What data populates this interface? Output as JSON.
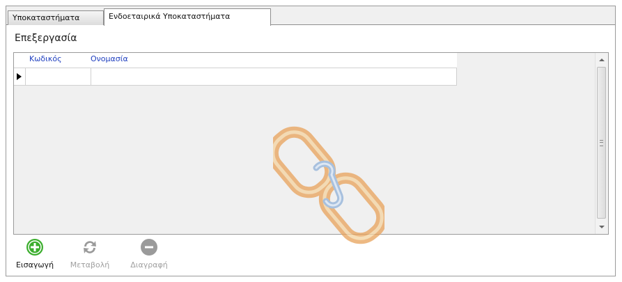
{
  "tabs": [
    {
      "label": "Υποκαταστήματα",
      "active": false
    },
    {
      "label": "Ενδοεταιρικά Υποκαταστήματα",
      "active": true
    }
  ],
  "section": {
    "title": "Επεξεργασία"
  },
  "grid": {
    "columns": [
      "Κωδικός",
      "Ονομασία"
    ],
    "rows": [
      {
        "code": "",
        "name": ""
      }
    ]
  },
  "toolbar": {
    "buttons": [
      {
        "label": "Εισαγωγή",
        "icon": "plus-circle-icon",
        "enabled": true,
        "color": "#3cae2e"
      },
      {
        "label": "Μεταβολή",
        "icon": "refresh-icon",
        "enabled": false,
        "color": "#9a9a9a"
      },
      {
        "label": "Διαγραφή",
        "icon": "minus-circle-icon",
        "enabled": false,
        "color": "#9a9a9a"
      }
    ]
  },
  "colors": {
    "column_header_text": "#1f3fbf",
    "grid_background": "#f0f0f0",
    "watermark_primary": "#e8a25a",
    "watermark_link": "#8fb0d8"
  }
}
